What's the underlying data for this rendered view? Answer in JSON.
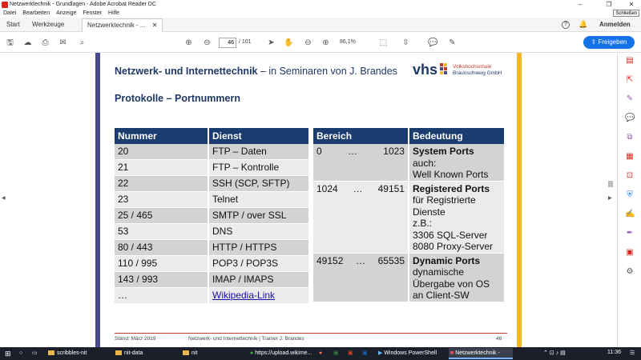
{
  "window": {
    "title": "Netzwerktechnik - Grundlagen - Adobe Acrobat Reader DC",
    "close_tooltip": "Schließen"
  },
  "menu": [
    "Datei",
    "Bearbeiten",
    "Anzeige",
    "Fenster",
    "Hilfe"
  ],
  "tabs": {
    "start": "Start",
    "tools": "Werkzeuge",
    "document": "Netzwerktechnik - ...",
    "signin": "Anmelden"
  },
  "toolbar": {
    "page_current": "46",
    "page_total": "/ 101",
    "zoom": "86,1%",
    "share_label": "Freigeben"
  },
  "slide": {
    "header_bold": "Netzwerk- und Internettechnik",
    "header_rest": " – in Seminaren von J. Brandes",
    "logo_text": "vhs",
    "logo_line1": "Volkshochschule",
    "logo_line2": "Braunschweig GmbH",
    "subheading": "Protokolle – Portnummern",
    "ports_table": {
      "headers": [
        "Nummer",
        "Dienst"
      ],
      "rows": [
        [
          "20",
          "FTP – Daten"
        ],
        [
          "21",
          "FTP – Kontrolle"
        ],
        [
          "22",
          "SSH (SCP, SFTP)"
        ],
        [
          "23",
          "Telnet"
        ],
        [
          "25 / 465",
          "SMTP / over SSL"
        ],
        [
          "53",
          "DNS"
        ],
        [
          "80 / 443",
          "HTTP / HTTPS"
        ],
        [
          "110 / 995",
          "POP3 / POP3S"
        ],
        [
          "143 / 993",
          "IMAP / IMAPS"
        ],
        [
          "…",
          "Wikipedia-Link"
        ]
      ]
    },
    "ranges_table": {
      "headers": [
        "Bereich",
        "Bedeutung"
      ],
      "rows": [
        {
          "from": "0",
          "dots": "…",
          "to": "1023",
          "title": "System Ports",
          "lines": [
            "auch:",
            "Well Known Ports"
          ]
        },
        {
          "from": "1024",
          "dots": "…",
          "to": "49151",
          "title": "Registered Ports",
          "lines": [
            "für Registrierte",
            "Dienste",
            "z.B.:",
            "3306 SQL-Server",
            "8080 Proxy-Server"
          ]
        },
        {
          "from": "49152",
          "dots": "…",
          "to": "65535",
          "title": "Dynamic Ports",
          "lines": [
            "dynamische",
            "Übergabe von OS",
            "an Client-SW"
          ]
        }
      ]
    },
    "footer_left": "Stand: März 2019",
    "footer_center": "Netzwerk- und Internettechnik | Trainer J. Brandes",
    "footer_page": "46"
  },
  "taskbar": {
    "items": [
      "scribbles-nit",
      "nit-data",
      "nit",
      "https://upload.wikime...",
      "Windows PowerShell",
      "Netzwerktechnik - Gru..."
    ],
    "clock": "11:36"
  },
  "colors": {
    "accent": "#1473e6",
    "table_header": "#1a3c6e",
    "slide_text": "#1f3864",
    "left_stripe": "#4a4a8a",
    "right_stripe": "#f5b82a"
  }
}
